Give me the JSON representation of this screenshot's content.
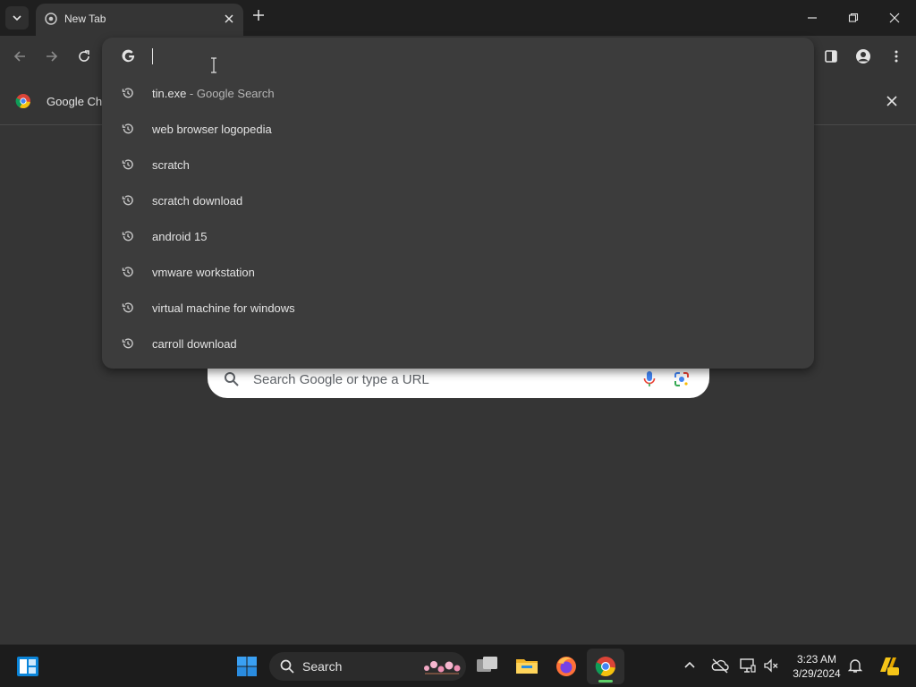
{
  "browser": {
    "tab_title": "New Tab",
    "bookmark_label": "Google Chr"
  },
  "omnibox": {
    "value": "",
    "suggestions": [
      {
        "text": "tin.exe",
        "desc": " - Google Search"
      },
      {
        "text": "web browser logopedia",
        "desc": ""
      },
      {
        "text": "scratch",
        "desc": ""
      },
      {
        "text": "scratch download",
        "desc": ""
      },
      {
        "text": "android 15",
        "desc": ""
      },
      {
        "text": "vmware workstation",
        "desc": ""
      },
      {
        "text": "virtual machine for windows",
        "desc": ""
      },
      {
        "text": "carroll download",
        "desc": ""
      }
    ]
  },
  "ntp": {
    "search_placeholder": "Search Google or type a URL"
  },
  "taskbar": {
    "search_label": "Search",
    "time": "3:23 AM",
    "date": "3/29/2024"
  },
  "colors": {
    "frame": "#1f1f1f",
    "toolbar": "#353535",
    "dropdown": "#3c3c3c",
    "taskbar": "#1c1c1c"
  }
}
